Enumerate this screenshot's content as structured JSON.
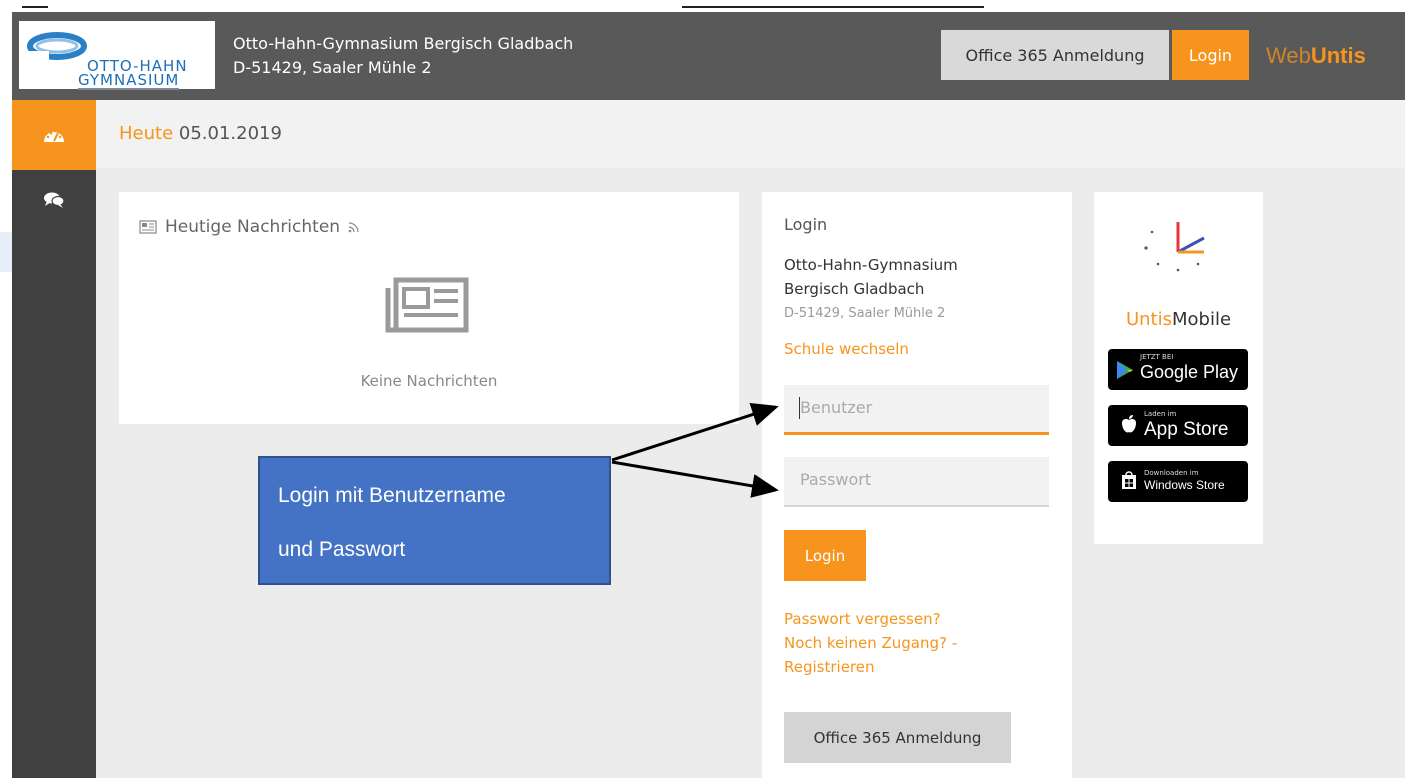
{
  "header": {
    "logo_line1": "OTTO-HAHN",
    "logo_line2": "GYMNASIUM",
    "school_name": "Otto-Hahn-Gymnasium Bergisch Gladbach",
    "school_address": "D-51429, Saaler Mühle 2",
    "office365_label": "Office 365 Anmeldung",
    "login_label": "Login",
    "brand_web": "Web",
    "brand_untis": "Untis"
  },
  "sidebar": {
    "items": [
      {
        "icon": "dashboard-icon",
        "active": true
      },
      {
        "icon": "chat-icon",
        "active": false
      }
    ]
  },
  "breadcrumb": {
    "label": "Heute",
    "date": "05.01.2019"
  },
  "news": {
    "title": "Heutige Nachrichten",
    "empty_text": "Keine Nachrichten"
  },
  "login": {
    "title": "Login",
    "school_line1": "Otto-Hahn-Gymnasium",
    "school_line2": "Bergisch Gladbach",
    "address": "D-51429, Saaler Mühle 2",
    "change_school": "Schule wechseln",
    "username_placeholder": "Benutzer",
    "password_placeholder": "Passwort",
    "login_button": "Login",
    "forgot_password": "Passwort vergessen?",
    "no_access_line1": "Noch keinen Zugang? -",
    "no_access_line2": "Registrieren",
    "office365_button": "Office 365 Anmeldung"
  },
  "mobile": {
    "title_untis": "Untis",
    "title_mobile": "Mobile",
    "google_small": "JETZT BEI",
    "google_big": "Google Play",
    "apple_small": "Laden im",
    "apple_big": "App Store",
    "windows_small": "Downloaden im",
    "windows_big": "Windows Store"
  },
  "annotation": {
    "line1": "Login mit Benutzername",
    "line2": "und Passwort"
  },
  "colors": {
    "accent": "#f7941d",
    "header_bg": "#595959",
    "sidebar_bg": "#404040",
    "callout_bg": "#4472c4"
  }
}
